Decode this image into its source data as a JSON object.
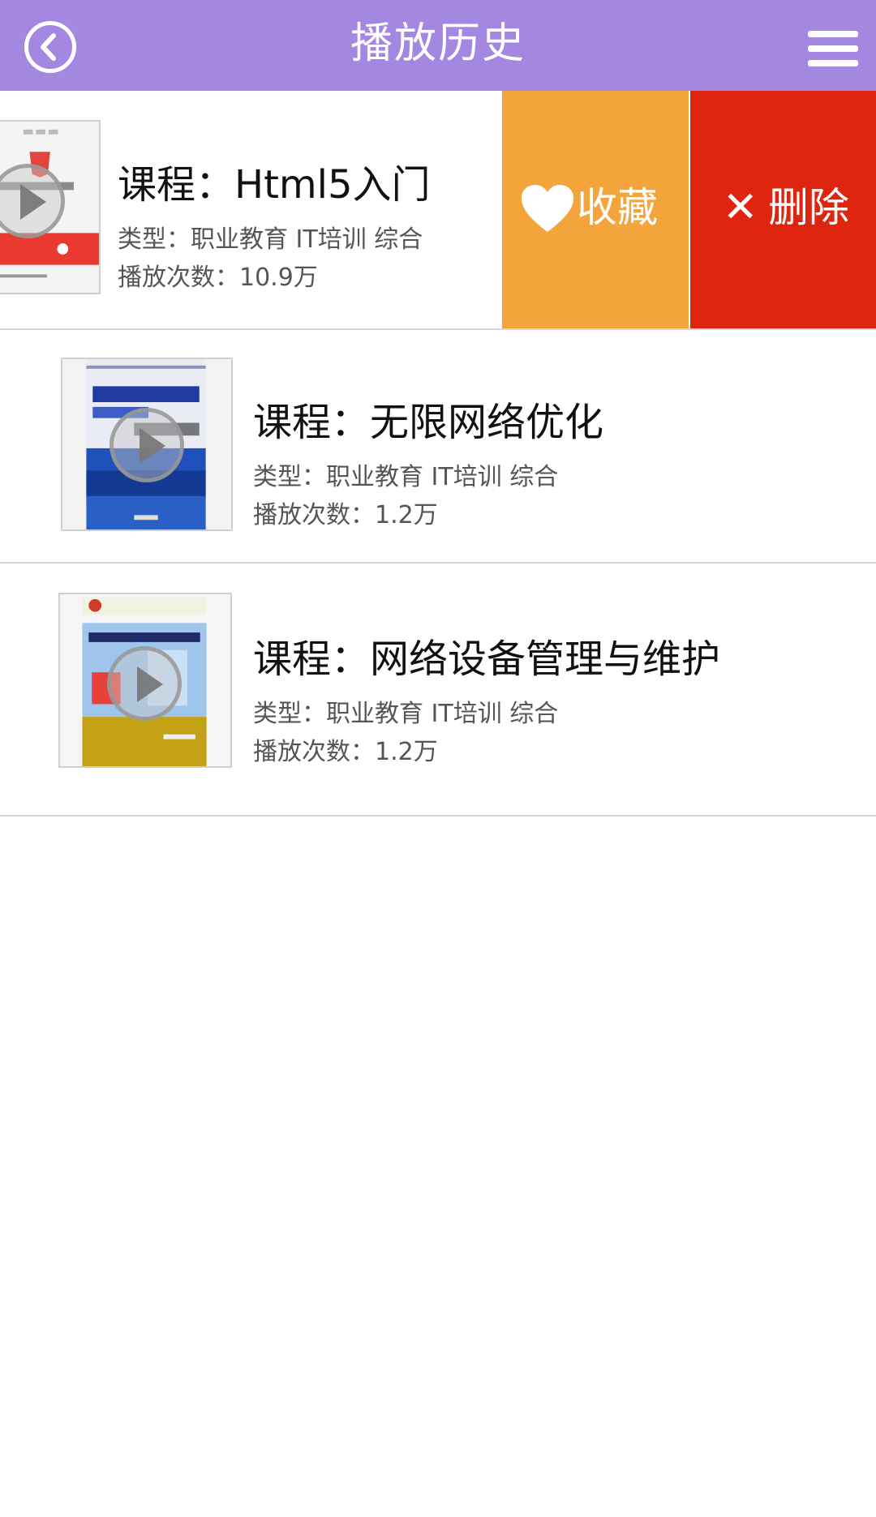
{
  "header": {
    "title": "播放历史",
    "back_icon": "chevron-left-circle-icon",
    "menu_icon": "hamburger-menu-icon",
    "background": "#a387e0"
  },
  "courses": [
    {
      "title": "课程：Html5入门",
      "type": "类型：职业教育 IT培训 综合",
      "plays": "播放次数：10.9万"
    },
    {
      "title": "课程：无限网络优化",
      "type": "类型：职业教育 IT培训 综合",
      "plays": "播放次数：1.2万"
    },
    {
      "title": "课程：网络设备管理与维护",
      "type": "类型：职业教育 IT培训 综合",
      "plays": "播放次数：1.2万"
    }
  ],
  "swipe_actions": {
    "favorite_label": "收藏",
    "favorite_icon": "heart-icon",
    "favorite_color": "#f3a53b",
    "delete_label": "删除",
    "delete_icon": "close-icon",
    "delete_color": "#de2510"
  }
}
